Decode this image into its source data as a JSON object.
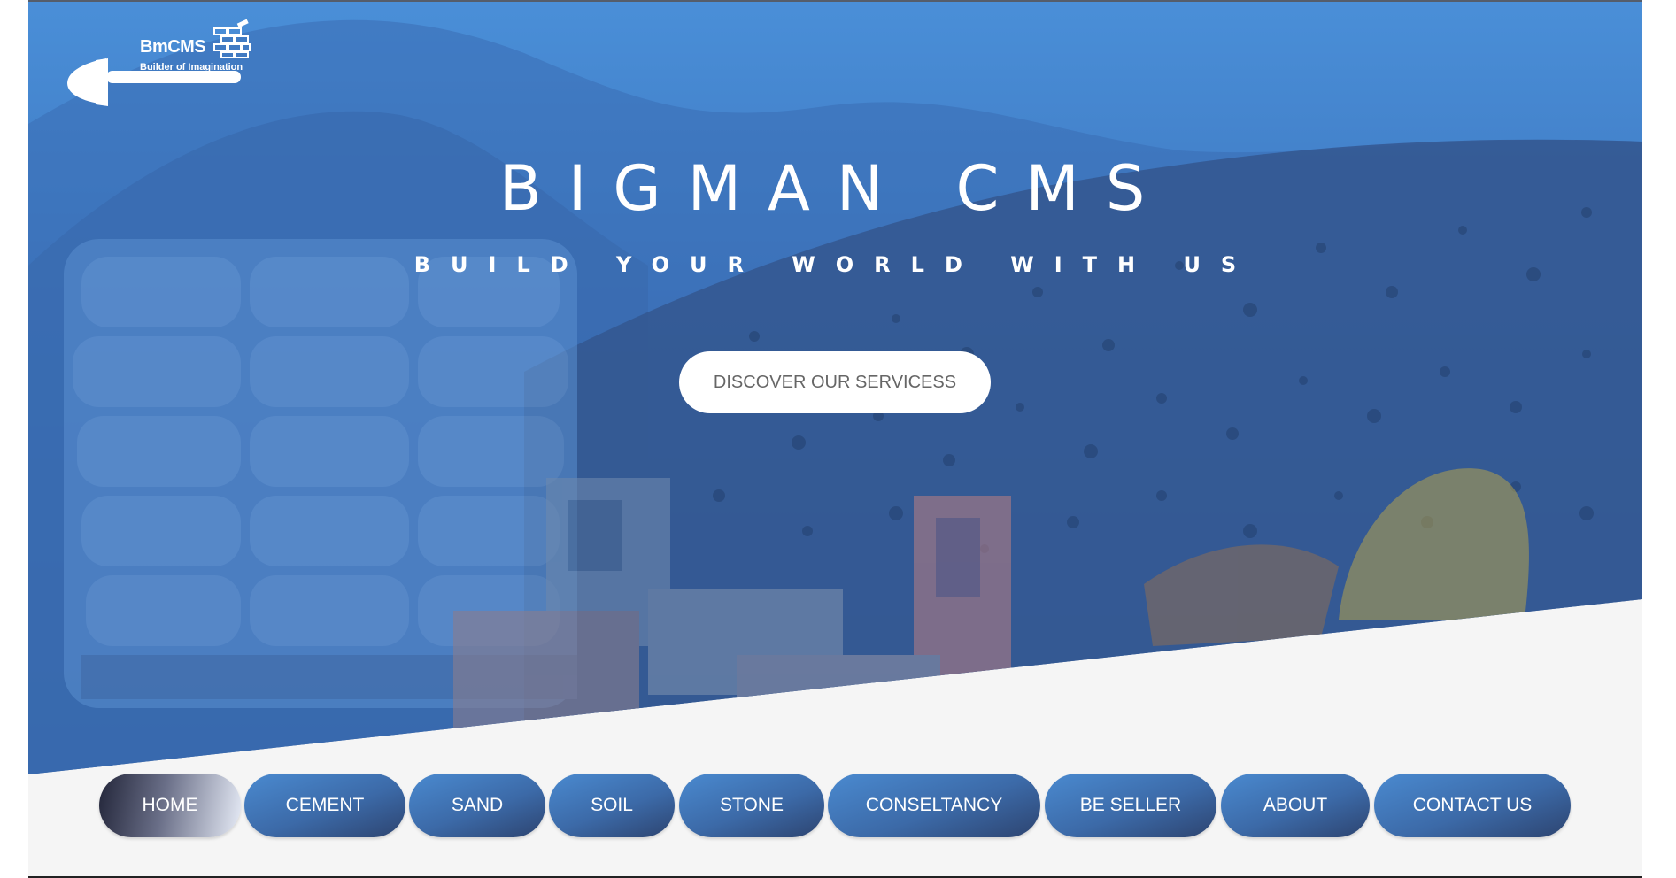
{
  "logo": {
    "title": "BmCMS",
    "tagline": "Builder of Imagination"
  },
  "hero": {
    "title": "BIGMAN CMS",
    "subtitle": "BUILD YOUR WORLD WITH US",
    "cta_label": "DISCOVER OUR SERVICESS"
  },
  "nav": {
    "items": [
      {
        "label": "HOME",
        "active": true
      },
      {
        "label": "CEMENT",
        "active": false
      },
      {
        "label": "SAND",
        "active": false
      },
      {
        "label": "SOIL",
        "active": false
      },
      {
        "label": "STONE",
        "active": false
      },
      {
        "label": "CONSELTANCY",
        "active": false
      },
      {
        "label": "BE SELLER",
        "active": false
      },
      {
        "label": "ABOUT",
        "active": false
      },
      {
        "label": "CONTACT US",
        "active": false
      }
    ]
  },
  "colors": {
    "hero_top": "#4a8fd8",
    "hero_bottom": "#2f538e",
    "nav_button": "#3c6aa8",
    "cta_text": "#666666"
  }
}
